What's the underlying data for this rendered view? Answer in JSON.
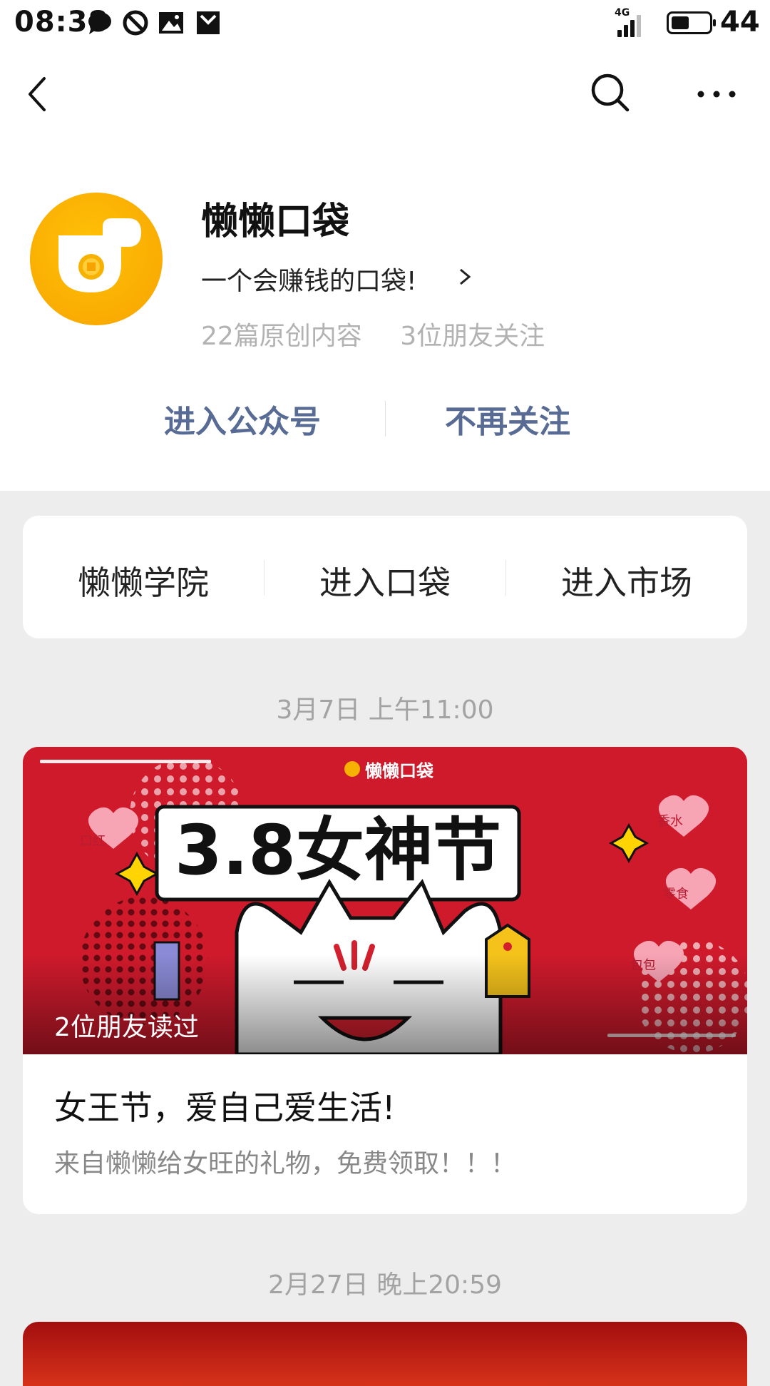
{
  "status_bar": {
    "time": "08:38",
    "network": "4G",
    "battery": "44",
    "icons": [
      "message-icon",
      "no-disturb-icon",
      "gallery-icon",
      "mail-icon"
    ]
  },
  "profile": {
    "name": "懒懒口袋",
    "slogan": "一个会赚钱的口袋!",
    "original_count": "22篇原创内容",
    "friends_follow": "3位朋友关注"
  },
  "actions": {
    "enter": "进入公众号",
    "unfollow": "不再关注"
  },
  "menu": [
    "懒懒学院",
    "进入口袋",
    "进入市场"
  ],
  "articles": [
    {
      "date": "3月7日 上午11:00",
      "cover_logo": "懒懒口袋",
      "cover_headline": "3.8女神节",
      "cover_tags": [
        "口红",
        "香水",
        "零食",
        "包包"
      ],
      "read_by": "2位朋友读过",
      "title": "女王节，爱自己爱生活!",
      "desc": "来自懒懒给女旺的礼物，免费领取！！！"
    },
    {
      "date": "2月27日 晚上20:59"
    }
  ],
  "colors": {
    "link": "#576b95",
    "cover_red": "#cf1a2c",
    "avatar_yellow": "#f7a300"
  }
}
